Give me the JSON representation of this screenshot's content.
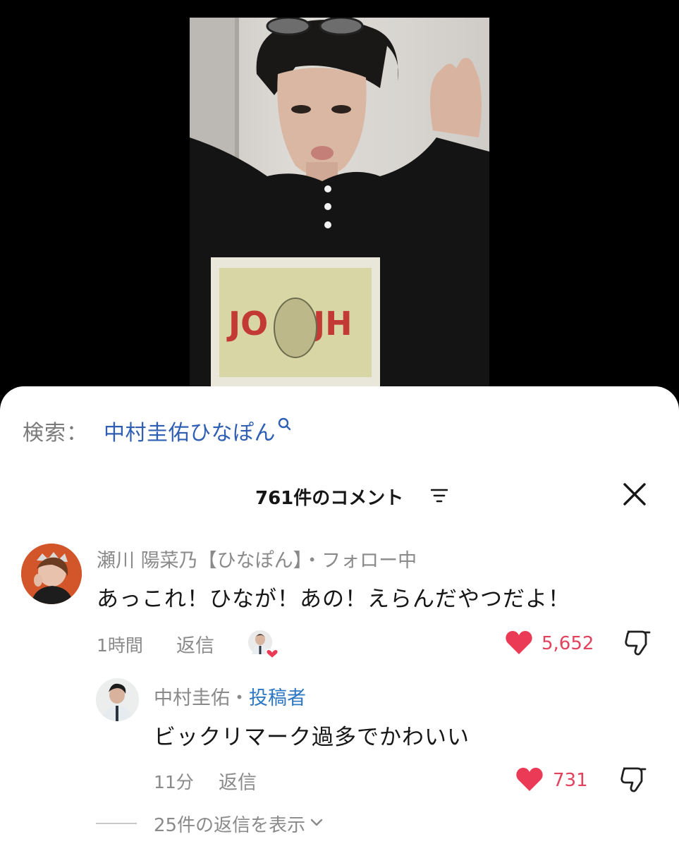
{
  "search": {
    "label": "検索：",
    "term": "中村圭佑ひなぽん"
  },
  "comments_header": {
    "count_label": "761件のコメント"
  },
  "comments": [
    {
      "author": "瀬川 陽菜乃【ひなぽん】",
      "badge": "・フォロー中",
      "text": "あっこれ！ひなが！あの！えらんだやつだよ！",
      "time": "1時間",
      "reply_label": "返信",
      "likes": "5,652"
    }
  ],
  "reply": {
    "author": "中村圭佑",
    "separator": "・",
    "badge": "投稿者",
    "text": "ビックリマーク過多でかわいい",
    "time": "11分",
    "reply_label": "返信",
    "likes": "731"
  },
  "view_replies": "25件の返信を表示",
  "colors": {
    "accent_blue": "#2f5fb3",
    "like_red": "#e2425e",
    "heart_red": "#ea3a56"
  }
}
